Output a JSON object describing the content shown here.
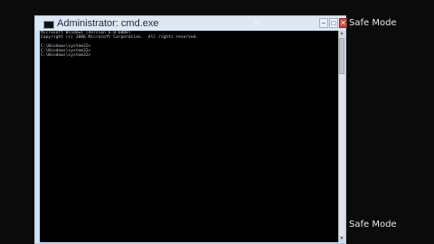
{
  "desktop": {
    "safe_mode_top": "Safe Mode",
    "safe_mode_bottom": "Safe Mode"
  },
  "window": {
    "title": "Administrator: cmd.exe",
    "buttons": {
      "minimize": "–",
      "maximize": "□",
      "close": "✕"
    }
  },
  "console": {
    "lines": [
      "Microsoft Windows [Version 6.0.6000]",
      "Copyright (c) 2006 Microsoft Corporation.  All rights reserved.",
      "",
      "C:\\Windows\\system32>",
      "C:\\Windows\\system32>",
      "C:\\Windows\\system32>"
    ]
  },
  "scrollbar": {
    "up": "▲",
    "down": "▼"
  },
  "colors": {
    "desktop_bg": "#0b0b0b",
    "titlebar": "#dce8f4",
    "console_bg": "#000000",
    "console_text": "#c8c8c8"
  }
}
